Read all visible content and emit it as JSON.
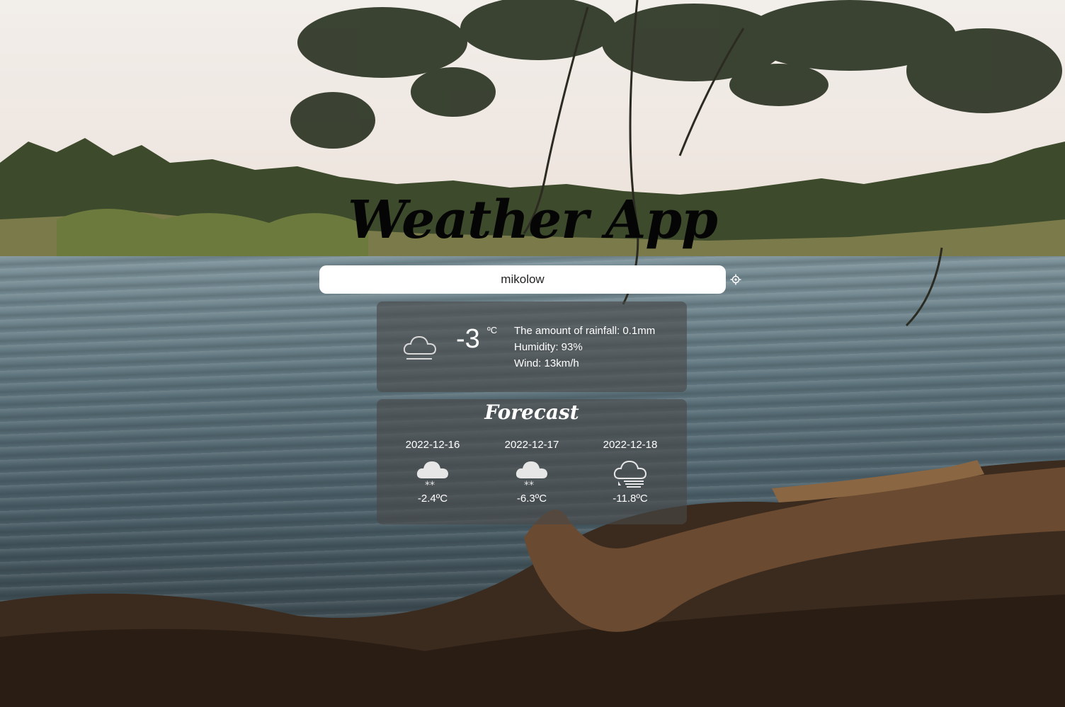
{
  "app": {
    "title": "Weather App"
  },
  "search": {
    "value": "mikolow"
  },
  "current": {
    "icon": "cloud-icon",
    "temperature": "-3",
    "unit": "ºC",
    "rainfall": "The amount of rainfall: 0.1mm",
    "humidity": "Humidity: 93%",
    "wind": "Wind: 13km/h"
  },
  "forecast": {
    "title": "Forecast",
    "days": [
      {
        "date": "2022-12-16",
        "icon": "snow-cloud-icon",
        "temp": "-2.4ºC"
      },
      {
        "date": "2022-12-17",
        "icon": "snow-cloud-icon",
        "temp": "-6.3ºC"
      },
      {
        "date": "2022-12-18",
        "icon": "wind-cloud-icon",
        "temp": "-11.8ºC"
      }
    ]
  },
  "colors": {
    "card_bg": "#484848",
    "search_bg": "#ffffff",
    "text": "#ffffff"
  }
}
